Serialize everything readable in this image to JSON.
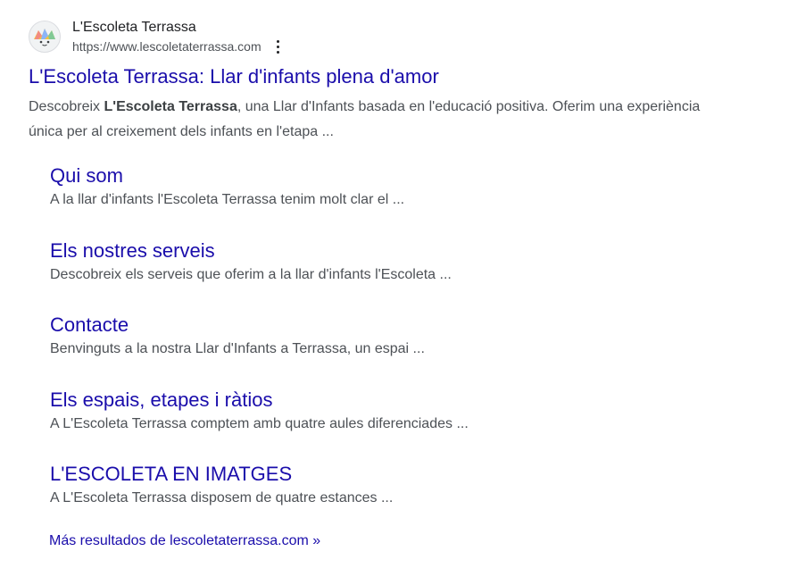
{
  "site": {
    "name": "L'Escoleta Terrassa",
    "url": "https://www.lescoletaterrassa.com",
    "favicon_icon": "escoleta-logo-icon",
    "more_options_icon": "more-vert-icon"
  },
  "result": {
    "title": "L'Escoleta Terrassa: Llar d'infants plena d'amor",
    "snippet_before": "Descobreix ",
    "snippet_bold": "L'Escoleta Terrassa",
    "snippet_after": ", una Llar d'Infants basada en l'educació positiva. Oferim una experiència única per al creixement dels infants en l'etapa ..."
  },
  "sitelinks": [
    {
      "title": "Qui som",
      "description": "A la llar d'infants l'Escoleta Terrassa tenim molt clar el ..."
    },
    {
      "title": "Els nostres serveis",
      "description": "Descobreix els serveis que oferim a la llar d'infants l'Escoleta ..."
    },
    {
      "title": "Contacte",
      "description": "Benvinguts a la nostra Llar d'Infants a Terrassa, un espai ..."
    },
    {
      "title": "Els espais, etapes i ràtios",
      "description": "A L'Escoleta Terrassa comptem amb quatre aules diferenciades ..."
    },
    {
      "title": "L'ESCOLETA EN IMATGES",
      "description": "A L'Escoleta Terrassa disposem de quatre estances ..."
    }
  ],
  "more_results": "Más resultados de lescoletaterrassa.com »",
  "colors": {
    "link": "#1a0dab",
    "text": "#4d5156",
    "title_text": "#202124"
  }
}
